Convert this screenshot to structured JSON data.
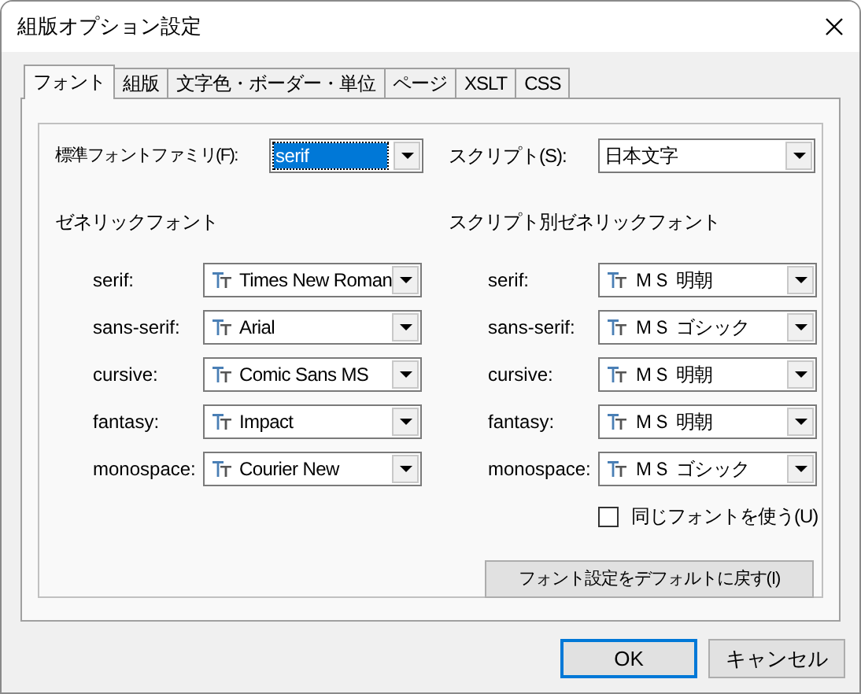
{
  "window": {
    "title": "組版オプション設定"
  },
  "tabs": [
    {
      "label": "フォント",
      "selected": true
    },
    {
      "label": "組版",
      "selected": false
    },
    {
      "label": "文字色・ボーダー・単位",
      "selected": false
    },
    {
      "label": "ページ",
      "selected": false
    },
    {
      "label": "XSLT",
      "selected": false
    },
    {
      "label": "CSS",
      "selected": false
    }
  ],
  "standard_font_family": {
    "label": "標準フォントファミリ(F):",
    "value": "serif",
    "focused": true
  },
  "script": {
    "label": "スクリプト(S):",
    "value": "日本文字"
  },
  "generic_fonts": {
    "heading": "ゼネリックフォント",
    "rows": [
      {
        "label": "serif:",
        "value": "Times New Roman"
      },
      {
        "label": "sans-serif:",
        "value": "Arial"
      },
      {
        "label": "cursive:",
        "value": "Comic Sans MS"
      },
      {
        "label": "fantasy:",
        "value": "Impact"
      },
      {
        "label": "monospace:",
        "value": "Courier New"
      }
    ]
  },
  "script_generic_fonts": {
    "heading": "スクリプト別ゼネリックフォント",
    "rows": [
      {
        "label": "serif:",
        "value": "ＭＳ 明朝"
      },
      {
        "label": "sans-serif:",
        "value": "ＭＳ ゴシック"
      },
      {
        "label": "cursive:",
        "value": "ＭＳ 明朝"
      },
      {
        "label": "fantasy:",
        "value": "ＭＳ 明朝"
      },
      {
        "label": "monospace:",
        "value": "ＭＳ ゴシック"
      }
    ]
  },
  "same_font_checkbox": {
    "label": "同じフォントを使う(U)",
    "checked": false
  },
  "reset_button": "フォント設定をデフォルトに戻す(I)",
  "buttons": [
    "OK",
    "キャンセル"
  ]
}
